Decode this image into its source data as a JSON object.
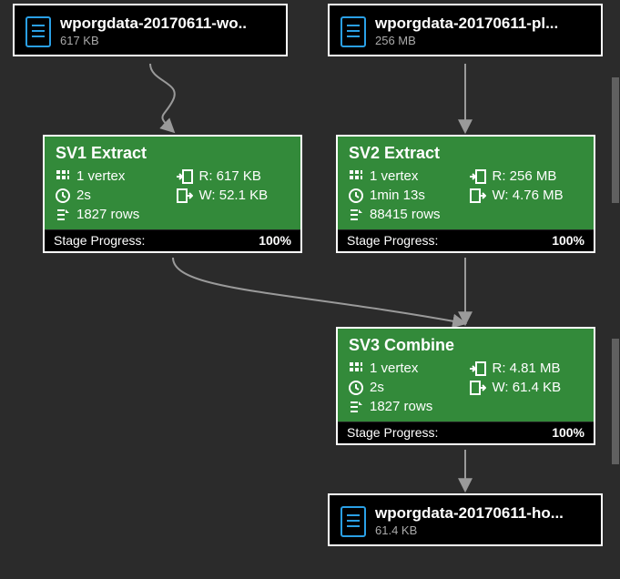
{
  "files": {
    "input1": {
      "name": "wporgdata-20170611-wo..",
      "size": "617 KB"
    },
    "input2": {
      "name": "wporgdata-20170611-pl...",
      "size": "256 MB"
    },
    "output": {
      "name": "wporgdata-20170611-ho...",
      "size": "61.4 KB"
    }
  },
  "stages": {
    "sv1": {
      "title": "SV1 Extract",
      "vertex": "1 vertex",
      "read": "R: 617 KB",
      "time": "2s",
      "write": "W: 52.1 KB",
      "rows": "1827 rows",
      "progress_label": "Stage Progress:",
      "progress_value": "100%"
    },
    "sv2": {
      "title": "SV2 Extract",
      "vertex": "1 vertex",
      "read": "R: 256 MB",
      "time": "1min 13s",
      "write": "W: 4.76 MB",
      "rows": "88415 rows",
      "progress_label": "Stage Progress:",
      "progress_value": "100%"
    },
    "sv3": {
      "title": "SV3 Combine",
      "vertex": "1 vertex",
      "read": "R: 4.81 MB",
      "time": "2s",
      "write": "W: 61.4 KB",
      "rows": "1827 rows",
      "progress_label": "Stage Progress:",
      "progress_value": "100%"
    }
  },
  "chart_data": {
    "type": "flow",
    "nodes": [
      {
        "id": "input1",
        "kind": "file",
        "label": "wporgdata-20170611-wo..",
        "size": "617 KB"
      },
      {
        "id": "input2",
        "kind": "file",
        "label": "wporgdata-20170611-pl...",
        "size": "256 MB"
      },
      {
        "id": "sv1",
        "kind": "stage",
        "label": "SV1 Extract",
        "vertices": 1,
        "read": "617 KB",
        "write": "52.1 KB",
        "duration_s": 2,
        "rows": 1827,
        "progress_pct": 100
      },
      {
        "id": "sv2",
        "kind": "stage",
        "label": "SV2 Extract",
        "vertices": 1,
        "read": "256 MB",
        "write": "4.76 MB",
        "duration_s": 73,
        "rows": 88415,
        "progress_pct": 100
      },
      {
        "id": "sv3",
        "kind": "stage",
        "label": "SV3 Combine",
        "vertices": 1,
        "read": "4.81 MB",
        "write": "61.4 KB",
        "duration_s": 2,
        "rows": 1827,
        "progress_pct": 100
      },
      {
        "id": "output",
        "kind": "file",
        "label": "wporgdata-20170611-ho...",
        "size": "61.4 KB"
      }
    ],
    "edges": [
      {
        "from": "input1",
        "to": "sv1"
      },
      {
        "from": "input2",
        "to": "sv2"
      },
      {
        "from": "sv1",
        "to": "sv3"
      },
      {
        "from": "sv2",
        "to": "sv3"
      },
      {
        "from": "sv3",
        "to": "output"
      }
    ]
  }
}
